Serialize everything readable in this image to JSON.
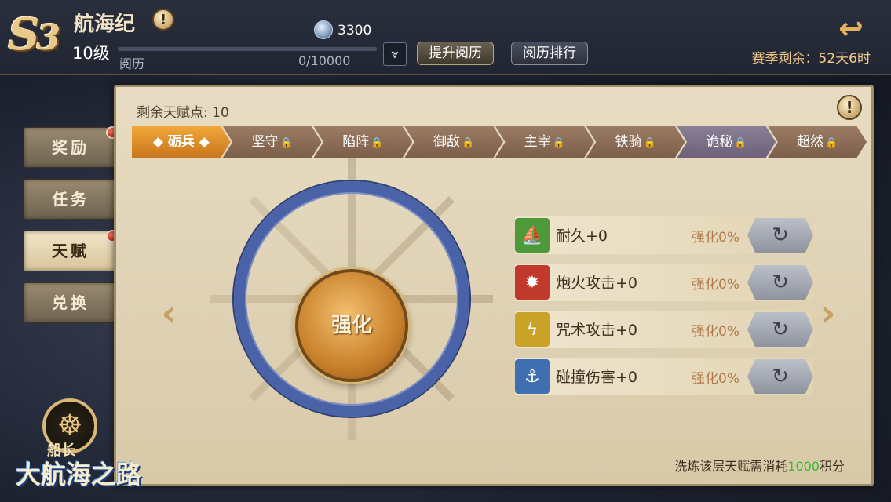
{
  "header": {
    "season_badge_letter": "S",
    "season_badge_number": "3",
    "title": "航海纪",
    "info_icon_glyph": "!",
    "level": "10级",
    "coin_value": "3300",
    "exp_label": "阅历",
    "exp_value": "0/10000",
    "exp_progress": 0,
    "dropdown_glyph": "⩔",
    "upgrade_button": "提升阅历",
    "rank_button": "阅历排行",
    "back_glyph": "↩",
    "season_remaining": "赛季剩余：52天6时"
  },
  "side_tabs": [
    {
      "label": "奖励",
      "badge": true,
      "active": false
    },
    {
      "label": "任务",
      "badge": false,
      "active": false
    },
    {
      "label": "天赋",
      "badge": true,
      "active": true
    },
    {
      "label": "兑换",
      "badge": false,
      "active": false
    }
  ],
  "panel": {
    "talent_points": "剩余天赋点: 10",
    "tabs": [
      {
        "label": "◆ 砺兵 ◆",
        "locked": false,
        "active": true
      },
      {
        "label": "坚守",
        "locked": true
      },
      {
        "label": "陷阵",
        "locked": true
      },
      {
        "label": "御敌",
        "locked": true
      },
      {
        "label": "主宰",
        "locked": true
      },
      {
        "label": "铁骑",
        "locked": true
      },
      {
        "label": "诡秘",
        "locked": true
      },
      {
        "label": "超然",
        "locked": true
      }
    ],
    "lock_glyph": "🔒",
    "core_label": "强化",
    "arrow_left": "‹",
    "arrow_right": "›",
    "stats": [
      {
        "name": "耐久+0",
        "pct": "强化0%",
        "icon": "ship-durability-icon",
        "color": "#4e9a3a",
        "glyph": "⛵"
      },
      {
        "name": "炮火攻击+0",
        "pct": "强化0%",
        "icon": "cannon-icon",
        "color": "#c0392b",
        "glyph": "✹"
      },
      {
        "name": "咒术攻击+0",
        "pct": "强化0%",
        "icon": "spell-icon",
        "color": "#c9a227",
        "glyph": "ϟ"
      },
      {
        "name": "碰撞伤害+0",
        "pct": "强化0%",
        "icon": "ram-icon",
        "color": "#3f6fb0",
        "glyph": "⚓"
      }
    ],
    "refresh_glyph": "↻",
    "footer_prefix": "洗炼该层天赋需消耗",
    "footer_cost": "1000",
    "footer_suffix": "积分"
  },
  "logo": {
    "sub": "船长",
    "main": "大航海之路",
    "wheel_glyph": "☸"
  }
}
